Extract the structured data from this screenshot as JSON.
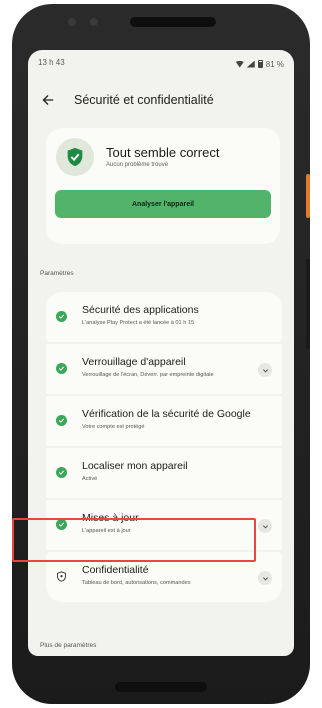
{
  "status_bar": {
    "time": "13 h 43",
    "battery": "81 %"
  },
  "app_bar": {
    "title": "Sécurité et confidentialité"
  },
  "status_card": {
    "title": "Tout semble correct",
    "subtitle": "Aucun problème trouvé",
    "button_label": "Analyser l'appareil"
  },
  "section_params": "Paramètres",
  "items": [
    {
      "title": "Sécurité des applications",
      "subtitle": "L'analyse Play Protect a été lancée à 01 h 15"
    },
    {
      "title": "Verrouillage d'appareil",
      "subtitle": "Verrouillage de l'écran, Déverr. par empreinte digitale"
    },
    {
      "title": "Vérification de la sécurité de Google",
      "subtitle": "Votre compte est protégé"
    },
    {
      "title": "Localiser mon appareil",
      "subtitle": "Activé"
    },
    {
      "title": "Mises à jour",
      "subtitle": "L'appareil est à jour"
    },
    {
      "title": "Confidentialité",
      "subtitle": "Tableau de bord, autorisations, commandes"
    }
  ],
  "section_more": "Plus de paramètres",
  "colors": {
    "accent_green": "#52b36a",
    "highlight_red": "#e8473c",
    "check_green": "#3aa85a"
  }
}
